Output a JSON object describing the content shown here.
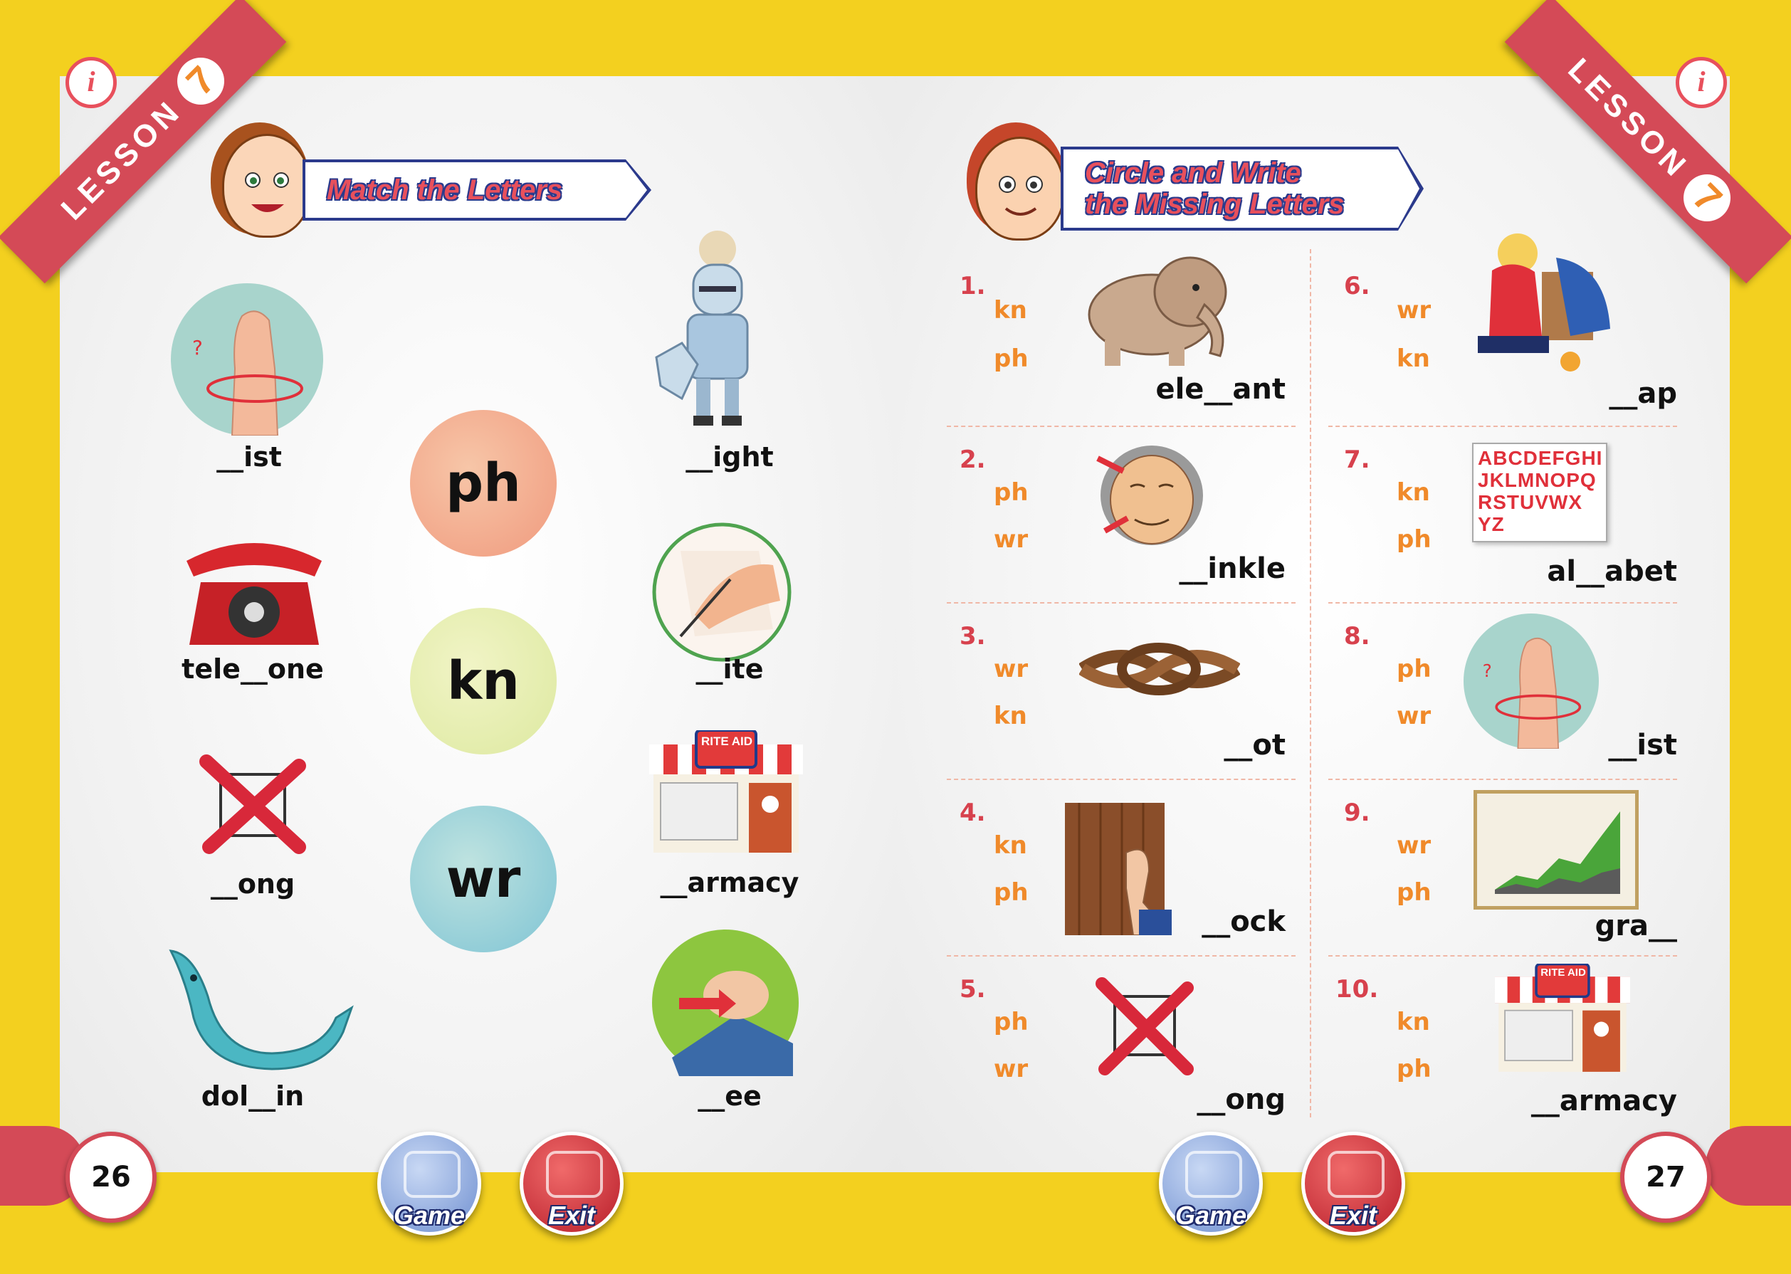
{
  "lesson": {
    "label": "LESSON",
    "number": "7"
  },
  "left_page": {
    "title": "Match the Letters",
    "page_number": "26",
    "left_words": [
      "__ist",
      "tele__one",
      "__ong",
      "dol__in"
    ],
    "letter_circles": [
      "ph",
      "kn",
      "wr"
    ],
    "right_words": [
      "__ight",
      "__ite",
      "__armacy",
      "__ee"
    ],
    "store_sign": "RITE AID"
  },
  "right_page": {
    "title_line1": "Circle and Write",
    "title_line2": "the Missing Letters",
    "page_number": "27",
    "alphabet_lines": [
      "ABCDEFGHI",
      "JKLMNOPQ",
      "RSTUVWX",
      "YZ"
    ],
    "store_sign": "RITE AID",
    "items": [
      {
        "num": "1.",
        "opt1": "kn",
        "opt2": "ph",
        "answer": "ele__ant",
        "picture": "elephant"
      },
      {
        "num": "2.",
        "opt1": "ph",
        "opt2": "wr",
        "answer": "__inkle",
        "picture": "wrinkle-face"
      },
      {
        "num": "3.",
        "opt1": "wr",
        "opt2": "kn",
        "answer": "__ot",
        "picture": "rope-knot"
      },
      {
        "num": "4.",
        "opt1": "kn",
        "opt2": "ph",
        "answer": "__ock",
        "picture": "knock-door"
      },
      {
        "num": "5.",
        "opt1": "ph",
        "opt2": "wr",
        "answer": "__ong",
        "picture": "wrong-cross"
      },
      {
        "num": "6.",
        "opt1": "wr",
        "opt2": "kn",
        "answer": "__ap",
        "picture": "wrap-gift"
      },
      {
        "num": "7.",
        "opt1": "kn",
        "opt2": "ph",
        "answer": "al__abet",
        "picture": "alphabet"
      },
      {
        "num": "8.",
        "opt1": "ph",
        "opt2": "wr",
        "answer": "__ist",
        "picture": "wrist"
      },
      {
        "num": "9.",
        "opt1": "wr",
        "opt2": "ph",
        "answer": "gra__",
        "picture": "graph"
      },
      {
        "num": "10.",
        "opt1": "kn",
        "opt2": "ph",
        "answer": "__armacy",
        "picture": "pharmacy"
      }
    ]
  },
  "nav": {
    "game_label": "Game",
    "exit_label": "Exit"
  },
  "colors": {
    "frame": "#f3d01f",
    "ribbon": "#d44a57",
    "option": "#f08a2a",
    "number": "#d7414d",
    "banner_border": "#2b3a8c"
  }
}
